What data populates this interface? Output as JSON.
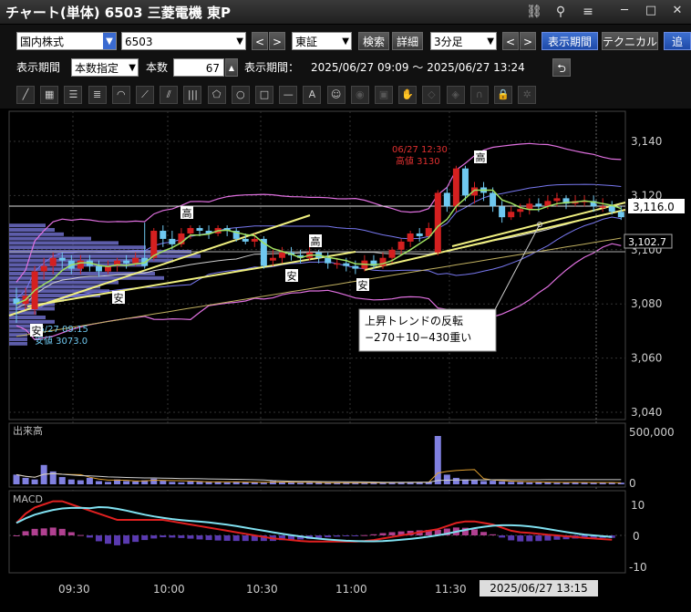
{
  "window": {
    "title": "チャート(単体) 6503 三菱電機 東P",
    "link_icon": "link-icon",
    "search_icon": "search-icon",
    "menu_icon": "menu-icon",
    "minimize": "─",
    "maximize": "□",
    "close": "✕"
  },
  "toolbar": {
    "market_select": "国内株式",
    "code_input": "6503",
    "exchange_select": "東証",
    "search_btn": "検索",
    "detail_btn": "詳細",
    "interval_select": "3分足",
    "period_btn": "表示期間",
    "technical_btn": "テクニカル",
    "extra_btn": "追",
    "prev": "<",
    "next": ">"
  },
  "period": {
    "label": "表示期間",
    "mode_select": "本数指定",
    "count_label": "本数",
    "count_value": "67",
    "range_label": "表示期間：",
    "range_value": "2025/06/27 09:09 ～ 2025/06/27 13:24"
  },
  "drawing_tools": [
    "line-tool",
    "ruler-tool",
    "parallel-lines-tool",
    "horizontal-lines-tool",
    "fan-tool",
    "gann-fan-tool",
    "speed-lines-tool",
    "fibonacci-tool",
    "pentagon-tool",
    "circle-tool",
    "rectangle-tool",
    "hline-tool",
    "text-tool",
    "icon-tool",
    "cursor-tool",
    "copy-tool",
    "hand-tool",
    "eraser-tool",
    "erase-all-tool",
    "magnet-tool",
    "lock-tool",
    "settings-tool"
  ],
  "price_axis": {
    "ticks": [
      "3,140",
      "3,120",
      "3,100",
      "3,080",
      "3,060",
      "3,040"
    ],
    "current_price": "3,116.0",
    "ref_price": "3,102.7"
  },
  "annotations": {
    "high_time": "06/27 12:30",
    "high_value": "高値 3130",
    "low_time": "06/27 09:15",
    "low_value": "安値 3073.0",
    "high_mark": "高",
    "low_mark": "安",
    "note_line1": "上昇トレンドの反転",
    "note_line2": "−270＋10−430重い"
  },
  "volume": {
    "label": "出来高",
    "ticks": [
      "500,000",
      "0"
    ]
  },
  "macd": {
    "label": "MACD",
    "ticks": [
      "10",
      "0",
      "-10"
    ]
  },
  "time_axis": {
    "ticks": [
      "09:30",
      "10:00",
      "10:30",
      "11:00",
      "11:30"
    ],
    "cursor_time": "2025/06/27 13:15"
  },
  "colors": {
    "up": "#d42020",
    "down": "#6fc8f0",
    "bollinger": "#e070e0",
    "ma_short": "#a0e060",
    "trendline": "#f0f080",
    "volume_bar": "#8080e0",
    "accent_blue": "#1e4aa8"
  }
}
